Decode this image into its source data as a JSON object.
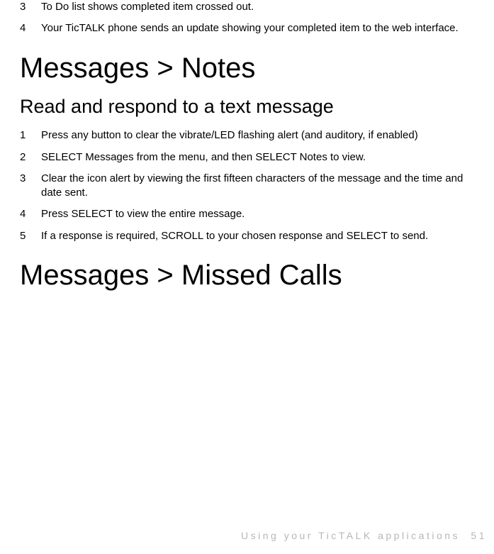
{
  "intro_steps": [
    {
      "num": "3",
      "text": "To Do list shows completed item crossed out."
    },
    {
      "num": "4",
      "text": "Your TicTALK phone sends an update showing your completed item to the web interface."
    }
  ],
  "section1": {
    "heading": "Messages > Notes",
    "subheading": "Read and respond to a text message",
    "steps": [
      {
        "num": "1",
        "text": "Press any button to clear the vibrate/LED flashing alert (and auditory, if enabled)"
      },
      {
        "num": "2",
        "text": "SELECT Messages from the menu, and then SELECT Notes to view."
      },
      {
        "num": "3",
        "text": "Clear the icon alert by viewing the first fifteen characters of the message and the time and date sent."
      },
      {
        "num": "4",
        "text": "Press SELECT to view the entire message."
      },
      {
        "num": "5",
        "text": "If a response is required, SCROLL to your chosen response and SELECT to send."
      }
    ]
  },
  "section2": {
    "heading": "Messages > Missed Calls"
  },
  "footer": {
    "text": "Using your TicTALK applications",
    "page": "51"
  }
}
